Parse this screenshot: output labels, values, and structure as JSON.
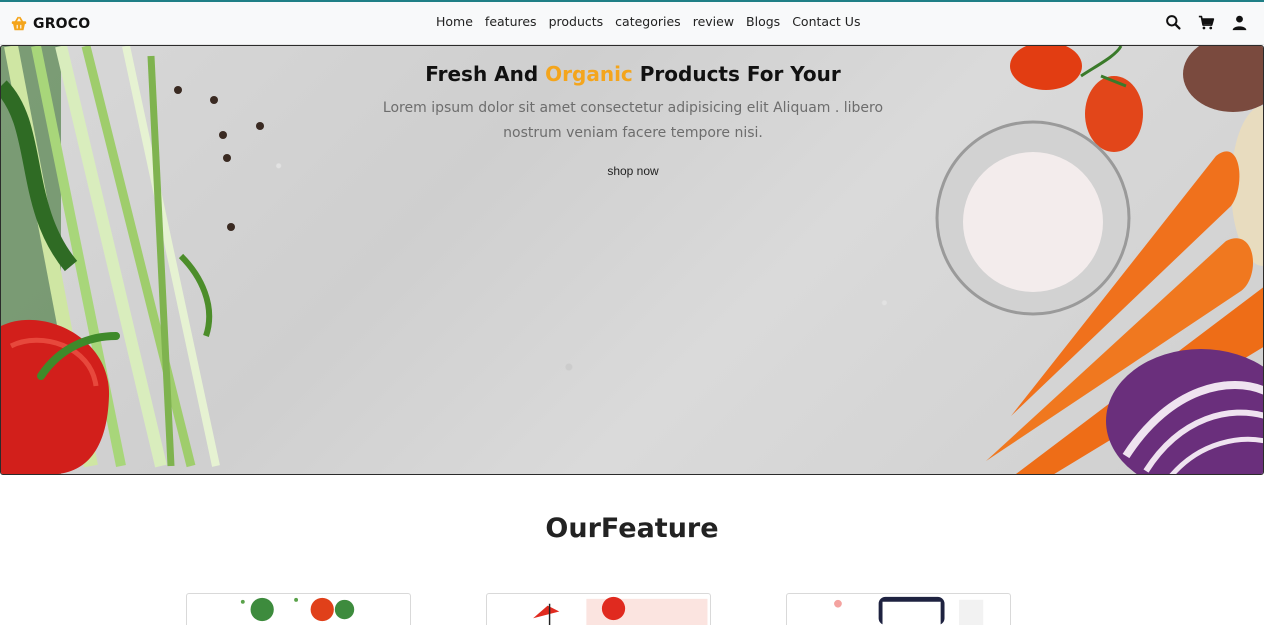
{
  "brand": {
    "name": "GROCO",
    "icon": "basket-icon",
    "accent_color": "#f4a51c"
  },
  "nav": {
    "links": [
      "Home",
      "features",
      "products",
      "categories",
      "review",
      "Blogs",
      "Contact Us"
    ],
    "icons": [
      "search-icon",
      "cart-icon",
      "user-icon"
    ]
  },
  "hero": {
    "title_start": "Fresh And ",
    "title_accent": "Organic",
    "title_end": " Products For Your",
    "text": "Lorem ipsum dolor sit amet consectetur adipisicing elit Aliquam . libero nostrum veniam facere tempore nisi.",
    "button": "shop now",
    "accent_color": "#f4a51c"
  },
  "features": {
    "title": "OurFeature",
    "cards": [
      {
        "illustration": "salad-illustration"
      },
      {
        "illustration": "delivery-illustration"
      },
      {
        "illustration": "mobile-order-illustration"
      }
    ]
  }
}
